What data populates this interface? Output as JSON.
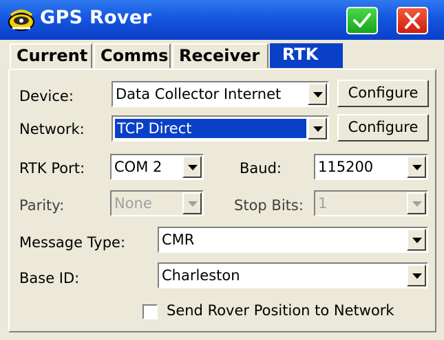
{
  "titlebar": {
    "title": "GPS Rover",
    "icon": "satellite-dish-icon",
    "ok_icon": "checkmark-icon",
    "close_icon": "close-icon",
    "accent": "#0a3fc8"
  },
  "tabs": [
    {
      "label": "Current",
      "active": false
    },
    {
      "label": "Comms",
      "active": false
    },
    {
      "label": "Receiver",
      "active": false
    },
    {
      "label": "RTK",
      "active": true
    }
  ],
  "form": {
    "device": {
      "label": "Device:",
      "value": "Data Collector Internet",
      "button": "Configure"
    },
    "network": {
      "label": "Network:",
      "value": "TCP Direct",
      "button": "Configure"
    },
    "rtk_port": {
      "label": "RTK Port:",
      "value": "COM 2"
    },
    "baud": {
      "label": "Baud:",
      "value": "115200"
    },
    "parity": {
      "label": "Parity:",
      "value": "None",
      "enabled": false
    },
    "stop_bits": {
      "label": "Stop Bits:",
      "value": "1",
      "enabled": false
    },
    "message_type": {
      "label": "Message Type:",
      "value": "CMR"
    },
    "base_id": {
      "label": "Base ID:",
      "value": "Charleston"
    },
    "send_position": {
      "label": "Send Rover Position to Network",
      "checked": false
    }
  }
}
